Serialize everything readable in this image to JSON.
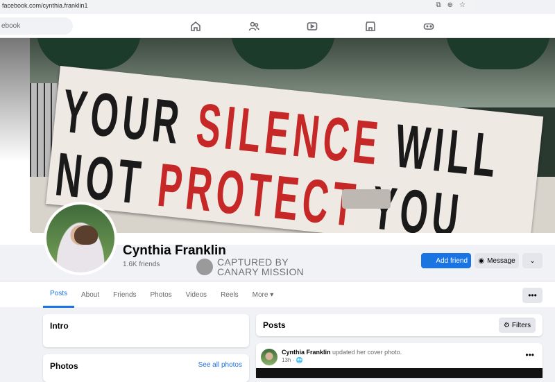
{
  "browser": {
    "url": "facebook.com/cynthia.franklin1"
  },
  "topnav": {
    "search_text": "ebook"
  },
  "cover": {
    "banner_line1_black": "YOUR ",
    "banner_line1_red": "SILENCE ",
    "banner_line1_black2": "WILL",
    "banner_line2_black": "NOT ",
    "banner_line2_red": "PROTECT ",
    "banner_line2_black2": "YOU"
  },
  "profile": {
    "name": "Cynthia Franklin",
    "friends": "1.6K friends"
  },
  "watermark": {
    "line1": "CAPTURED BY",
    "line2": "CANARY MISSION"
  },
  "actions": {
    "add_friend": "Add friend",
    "message": "Message",
    "more_icon": "chevron-down"
  },
  "tabs": [
    {
      "label": "Posts",
      "active": true
    },
    {
      "label": "About"
    },
    {
      "label": "Friends"
    },
    {
      "label": "Photos"
    },
    {
      "label": "Videos"
    },
    {
      "label": "Reels"
    },
    {
      "label": "More"
    }
  ],
  "intro": {
    "title": "Intro"
  },
  "photos": {
    "title": "Photos",
    "see_all": "See all photos"
  },
  "posts": {
    "title": "Posts",
    "filters": "Filters"
  },
  "post": {
    "author": "Cynthia Franklin",
    "action": "updated her cover photo.",
    "time": "13h"
  },
  "colors": {
    "primary": "#1b74e4",
    "banner_red": "#c62828"
  }
}
